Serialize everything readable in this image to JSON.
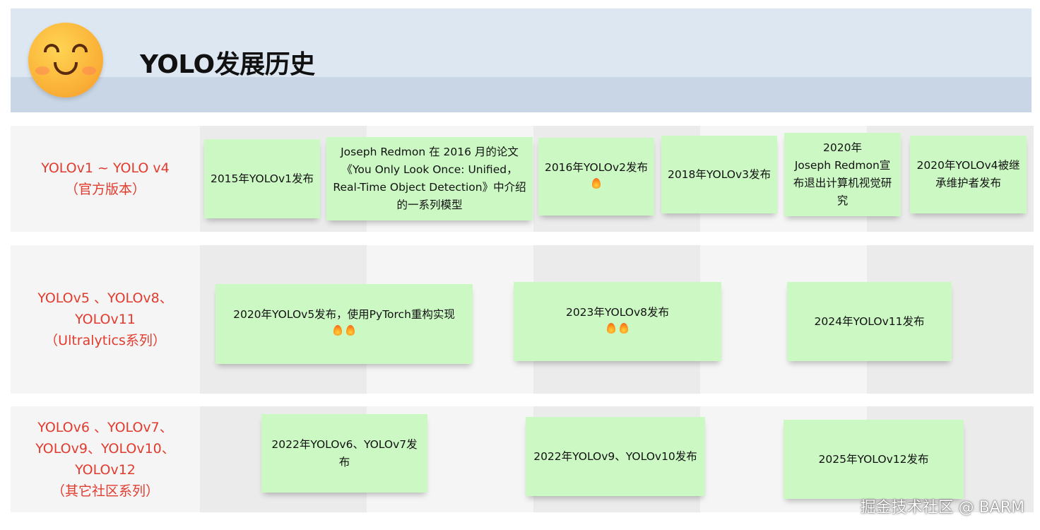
{
  "header": {
    "title": "YOLO发展历史",
    "icon": "smiling-face-icon"
  },
  "rows": [
    {
      "label_lines": [
        "YOLOv1 ~ YOLO v4",
        "（官方版本）"
      ],
      "notes": [
        {
          "lines": [
            "2015年YOLOv1发布"
          ],
          "fire": 0
        },
        {
          "lines": [
            "Joseph Redmon 在 2016 月的论文",
            "《You Only Look Once: Unified，",
            "Real-Time Object Detection》中介绍",
            "的一系列模型"
          ],
          "fire": 0
        },
        {
          "lines": [
            "2016年YOLOv2发布"
          ],
          "fire": 1
        },
        {
          "lines": [
            "2018年YOLOv3发布"
          ],
          "fire": 0
        },
        {
          "lines": [
            "2020年",
            "Joseph Redmon宣",
            "布退出计算机视觉研",
            "究"
          ],
          "fire": 0
        },
        {
          "lines": [
            "2020年YOLOv4被继",
            "承维护者发布"
          ],
          "fire": 0
        }
      ]
    },
    {
      "label_lines": [
        "YOLOv5 、YOLOv8、",
        "YOLOv11",
        "（Ultralytics系列）"
      ],
      "notes": [
        {
          "lines": [
            "2020年YOLOv5发布，使用PyTorch重构实现"
          ],
          "fire": 2
        },
        {
          "lines": [
            "2023年YOLOv8发布"
          ],
          "fire": 2
        },
        {
          "lines": [
            "2024年YOLOv11发布"
          ],
          "fire": 0
        }
      ]
    },
    {
      "label_lines": [
        "YOLOv6 、YOLOv7、",
        "YOLOv9、YOLOv10、",
        "YOLOv12",
        "（其它社区系列）"
      ],
      "notes": [
        {
          "lines": [
            "2022年YOLOv6、YOLOv7发布"
          ],
          "fire": 0
        },
        {
          "lines": [
            "2022年YOLOv9、YOLOv10发布"
          ],
          "fire": 0
        },
        {
          "lines": [
            "2025年YOLOv12发布"
          ],
          "fire": 0
        }
      ]
    }
  ],
  "watermark": "掘金技术社区 @ BARM",
  "colors": {
    "label": "#e23b2e",
    "note_bg": "#ccf8c4",
    "header_bg": "#dde7f2"
  }
}
